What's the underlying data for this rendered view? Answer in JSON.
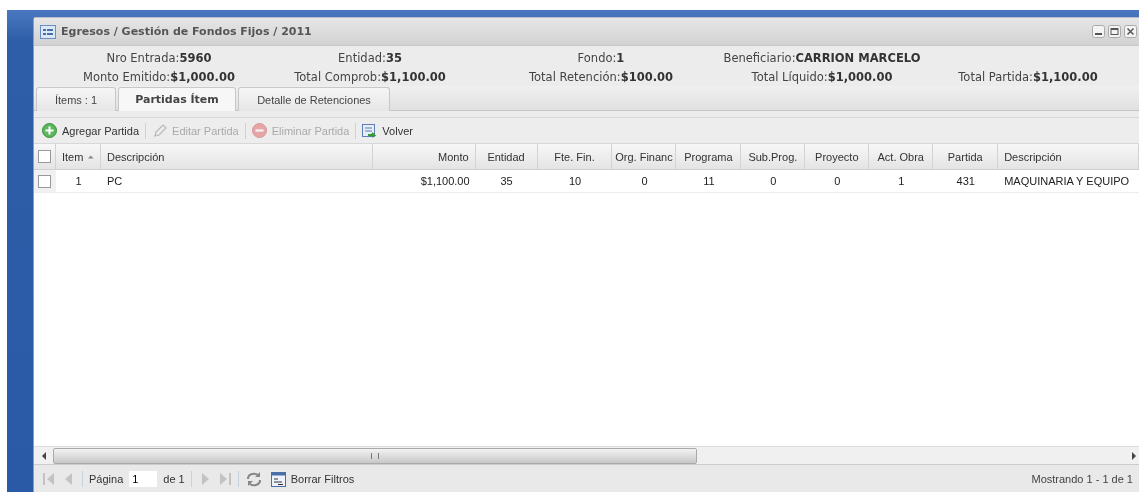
{
  "window": {
    "title": "Egresos / Gestión de Fondos Fijos / 2011"
  },
  "info_rows": [
    [
      {
        "label": "Nro Entrada:",
        "value": "5960"
      },
      {
        "label": "Entidad:",
        "value": "35"
      },
      {
        "label": "Fondo:",
        "value": "1"
      },
      {
        "label": "Beneficiario:",
        "value": "CARRION MARCELO"
      }
    ],
    [
      {
        "label": "Monto Emitido:",
        "value": "$1,000.00"
      },
      {
        "label": "Total Comprob:",
        "value": "$1,100.00"
      },
      {
        "label": "Total Retención:",
        "value": "$100.00"
      },
      {
        "label": "Total Líquido:",
        "value": "$1,000.00"
      },
      {
        "label": "Total Partida:",
        "value": "$1,100.00"
      }
    ]
  ],
  "tabs": [
    {
      "label": "Ítems : 1",
      "selected": false
    },
    {
      "label": "Partidas Ítem",
      "selected": true
    },
    {
      "label": "Detalle de Retenciones",
      "selected": false
    }
  ],
  "toolbar": [
    {
      "kind": "add",
      "label": "Agregar Partida",
      "disabled": false
    },
    {
      "kind": "edit",
      "label": "Editar Partida",
      "disabled": true
    },
    {
      "kind": "delete",
      "label": "Eliminar Partida",
      "disabled": true
    },
    {
      "kind": "back",
      "label": "Volver",
      "disabled": false
    }
  ],
  "table": {
    "all_checked": false,
    "columns": [
      {
        "label": "Item",
        "kind": "number",
        "sort_ascending": true
      },
      {
        "label": "Descripción",
        "kind": "text"
      },
      {
        "label": "Monto",
        "kind": "money"
      },
      {
        "label": "Entidad",
        "kind": "number"
      },
      {
        "label": "Fte. Fin.",
        "kind": "number"
      },
      {
        "label": "Org. Financ",
        "kind": "number"
      },
      {
        "label": "Programa",
        "kind": "number"
      },
      {
        "label": "Sub.Prog.",
        "kind": "number"
      },
      {
        "label": "Proyecto",
        "kind": "number"
      },
      {
        "label": "Act. Obra",
        "kind": "number"
      },
      {
        "label": "Partida",
        "kind": "number"
      },
      {
        "label": "Descripción",
        "kind": "text"
      }
    ],
    "rows": [
      {
        "checked": false,
        "cells": [
          "1",
          "PC",
          "$1,100.00",
          "35",
          "10",
          "0",
          "11",
          "0",
          "0",
          "1",
          "431",
          "MAQUINARIA Y EQUIPO"
        ]
      }
    ]
  },
  "pager": {
    "nav": [
      {
        "kind": "first",
        "disabled": true
      },
      {
        "kind": "prev",
        "disabled": true
      },
      {
        "kind": "next",
        "disabled": true
      },
      {
        "kind": "last",
        "disabled": true
      }
    ],
    "page_label": "Página",
    "page": "1",
    "of": "de 1",
    "clear_filters": "Borrar Filtros",
    "summary": "Mostrando 1 - 1 de 1"
  }
}
